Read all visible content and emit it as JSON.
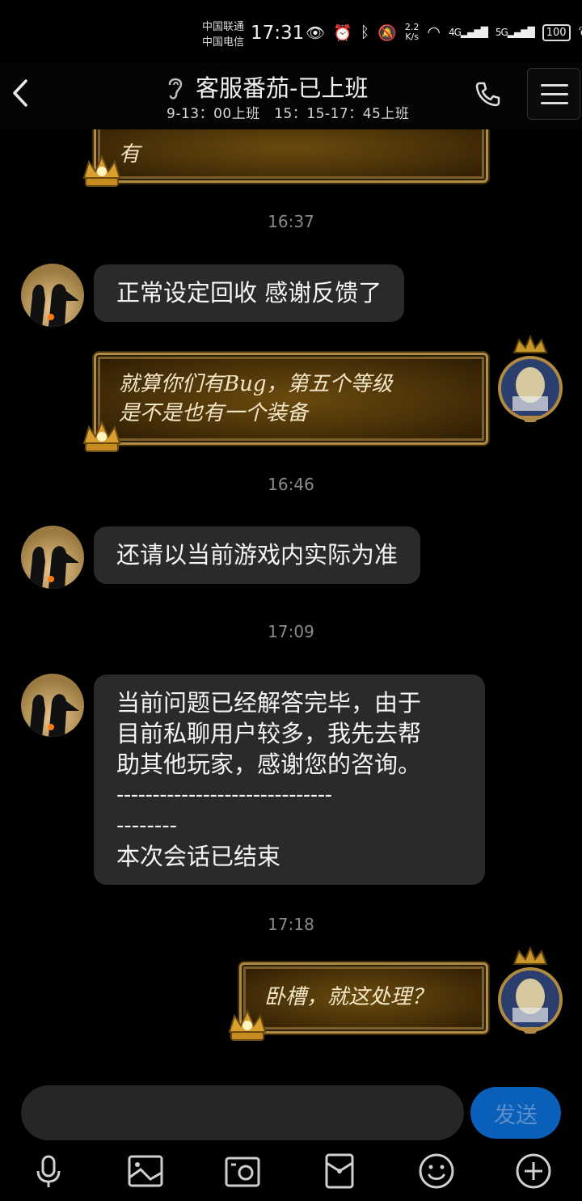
{
  "status_bar": {
    "carrier_1": "中国联通",
    "carrier_2": "中国电信",
    "time": "17:31",
    "net_speed_value": "2.2",
    "net_speed_unit": "K/s",
    "signal_1_label": "4G",
    "signal_2_label": "5G",
    "battery": "100"
  },
  "header": {
    "title": "客服番茄-已上班",
    "subtitle": "9-13：00上班　15：15-17：45上班"
  },
  "messages": [
    {
      "type": "gold",
      "side": "right",
      "text": "有"
    },
    {
      "type": "timestamp",
      "text": "16:37"
    },
    {
      "type": "text",
      "side": "left",
      "text": "正常设定回收 感谢反馈了"
    },
    {
      "type": "gold",
      "side": "right",
      "line1": "就算你们有Bug，第五个等级",
      "line2": "是不是也有一个装备"
    },
    {
      "type": "timestamp",
      "text": "16:46"
    },
    {
      "type": "text",
      "side": "left",
      "text": "还请以当前游戏内实际为准"
    },
    {
      "type": "timestamp",
      "text": "17:09"
    },
    {
      "type": "text",
      "side": "left",
      "line1": "当前问题已经解答完毕，由于",
      "line2": "目前私聊用户较多，我先去帮",
      "line3": "助其他玩家，感谢您的咨询。",
      "line4": "------------------------------",
      "line5": "--------",
      "line6": "本次会话已结束"
    },
    {
      "type": "timestamp",
      "text": "17:18"
    },
    {
      "type": "gold",
      "side": "right",
      "text": "卧槽，就这处理？"
    }
  ],
  "input": {
    "placeholder": "",
    "send_label": "发送"
  },
  "toolbar_icons": [
    "microphone-icon",
    "image-icon",
    "camera-icon",
    "red-packet-icon",
    "emoji-icon",
    "plus-icon"
  ],
  "colors": {
    "background": "#000000",
    "bubble_left": "#2a2a2a",
    "gold_border": "#b08a40",
    "send_button": "#0a5fb8"
  }
}
